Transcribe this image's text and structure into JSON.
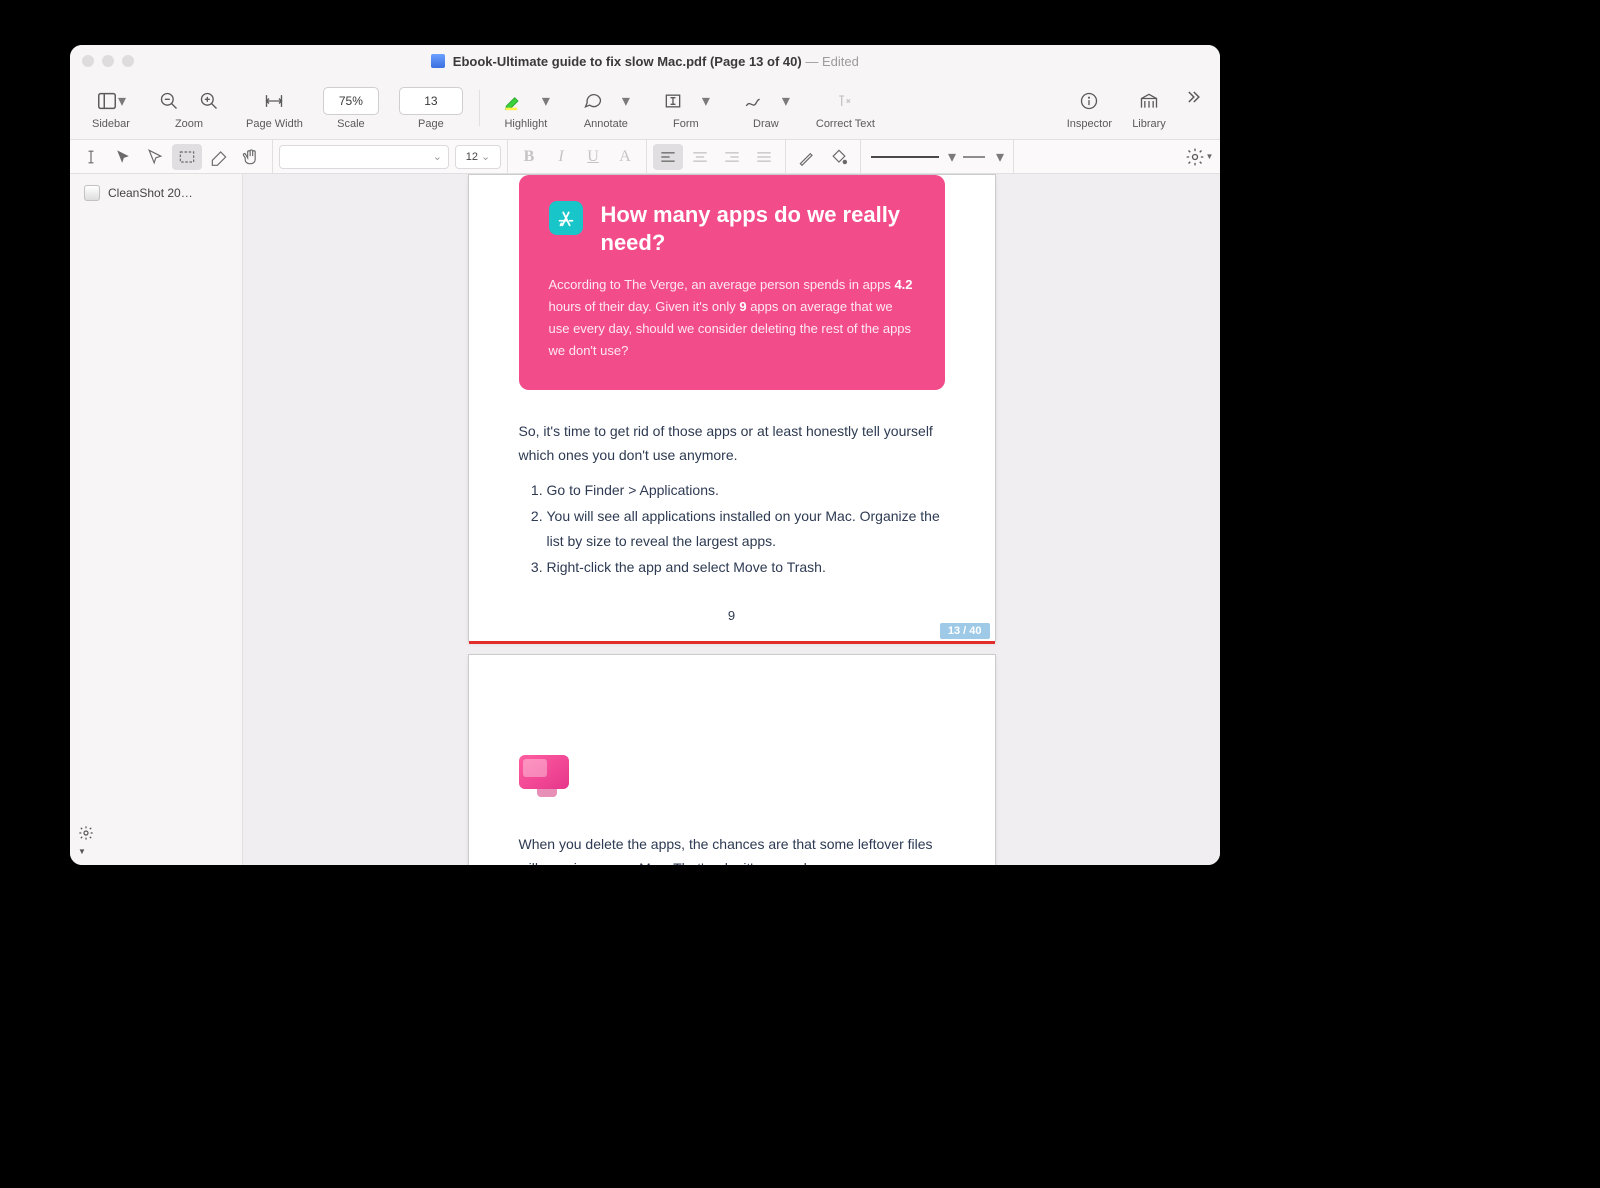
{
  "titlebar": {
    "filename": "Ebook-Ultimate guide to fix slow Mac.pdf",
    "page_info": "(Page 13 of 40)",
    "edited_label": "—  Edited"
  },
  "toolbar": {
    "sidebar_label": "Sidebar",
    "zoom_label": "Zoom",
    "pagewidth_label": "Page Width",
    "scale_label": "Scale",
    "scale_value": "75%",
    "page_label": "Page",
    "page_value": "13",
    "highlight_label": "Highlight",
    "annotate_label": "Annotate",
    "form_label": "Form",
    "draw_label": "Draw",
    "correct_label": "Correct Text",
    "inspector_label": "Inspector",
    "library_label": "Library"
  },
  "toolbar2": {
    "font_size": "12"
  },
  "sidebar": {
    "item_label": "CleanShot 20…"
  },
  "canvas": {
    "page_indicator": "13 / 40"
  },
  "doc": {
    "card_title": "How many apps do we really need?",
    "card_p1_a": "According to The Verge, an average person spends in apps ",
    "card_b1": "4.2",
    "card_p1_b": " hours of their day. Given it's only ",
    "card_b2": "9",
    "card_p1_c": " apps on average that we use every day, should we consider deleting the rest of the apps we don't use?",
    "intro": "So, it's time to get rid of those apps or at least honestly tell yourself which ones you don't use anymore.",
    "step1": "Go to Finder > Applications.",
    "step2": "You will see all applications installed on your Mac. Organize the list by size to reveal the largest apps.",
    "step3": "Right-click the app and select Move to Trash.",
    "page_num": "9",
    "p2_text": "When you delete the apps, the chances are that some leftover files will remain on your Mac. That's why it's a good"
  }
}
